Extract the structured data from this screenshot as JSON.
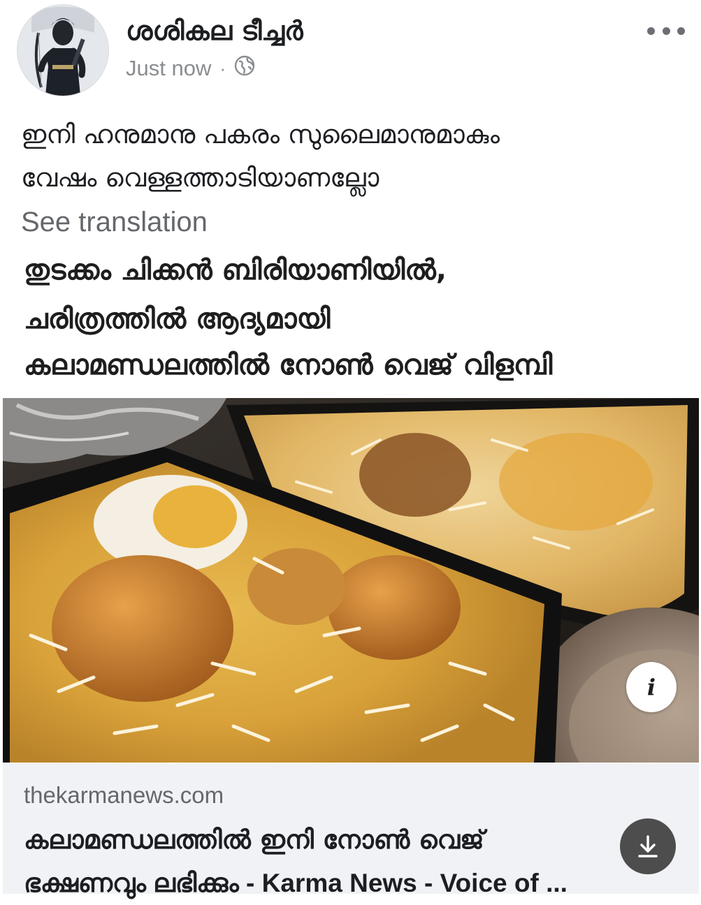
{
  "post": {
    "author": "ശശികല ടീച്ചർ",
    "timestamp": "Just now",
    "separator": "·",
    "privacy_icon": "globe-icon",
    "more_icon": "more-horizontal-icon",
    "caption_lines": [
      "ഇനി ഹനുമാനു പകരം സുലൈമാനുമാകും",
      "വേഷം വെള്ളത്താടിയാണല്ലോ"
    ],
    "see_translation": "See translation"
  },
  "shared": {
    "headline_lines": [
      "തുടക്കം ചിക്കൻ ബിരിയാണിയിൽ,",
      "ചരിത്രത്തിൽ ആദ്യമായി",
      "കലാമണ്ഡലത്തിൽ  നോൺ വെജ് വിളമ്പി"
    ],
    "info_icon": "info-icon",
    "info_glyph": "i",
    "link_domain": "thekarmanews.com",
    "link_title_line1": "കലാമണ്ഡലത്തിൽ ഇനി നോൺ വെജ്",
    "link_title_line2": "ഭക്ഷണവും ലഭിക്കും - Karma News - Voice of ...",
    "download_icon": "download-icon"
  },
  "colors": {
    "text_primary": "#1c1e21",
    "text_secondary": "#65676b",
    "meta_gray": "#8a8d91",
    "link_bg": "#f0f2f5"
  }
}
